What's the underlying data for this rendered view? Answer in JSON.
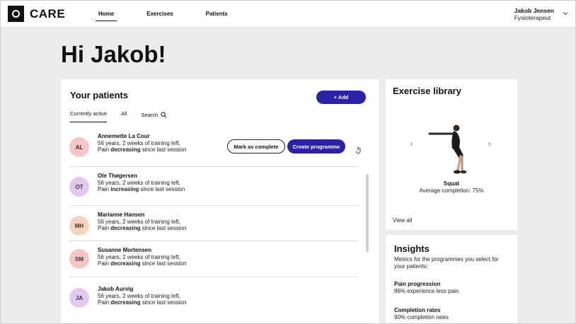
{
  "app": {
    "name": "CARE"
  },
  "nav": {
    "items": [
      "Home",
      "Exercises",
      "Patients"
    ]
  },
  "user": {
    "name": "Jakob Jensen",
    "role": "Fysioterapeut"
  },
  "greeting": "Hi Jakob!",
  "patients": {
    "title": "Your patients",
    "add_label": "+ Add",
    "tabs": [
      "Currently active",
      "All"
    ],
    "search_label": "Search",
    "mark_complete_label": "Mark as complete",
    "create_programme_label": "Create programme",
    "list": [
      {
        "initials": "AL",
        "name": "Annemette La Cour",
        "details": "56 years, 2 weeks of training left,",
        "pain_prefix": "Pain ",
        "pain_trend": "decreasing",
        "pain_suffix": " since last session",
        "avatar_color": "#f7c6c6"
      },
      {
        "initials": "OT",
        "name": "Ole Thøgersen",
        "details": "56 years, 2 weeks of training left,",
        "pain_prefix": "Pain ",
        "pain_trend": "increasing",
        "pain_suffix": " since last session",
        "avatar_color": "#e2c9f2"
      },
      {
        "initials": "MH",
        "name": "Marianne Hansen",
        "details": "56 years, 2 weeks of training left,",
        "pain_prefix": "Pain ",
        "pain_trend": "decreasing",
        "pain_suffix": " since last session",
        "avatar_color": "#f8d3bf"
      },
      {
        "initials": "SM",
        "name": "Susanne Mortensen",
        "details": "56 years, 2 weeks of training left,",
        "pain_prefix": "Pain ",
        "pain_trend": "decreasing",
        "pain_suffix": " since last session",
        "avatar_color": "#f7c6c6"
      },
      {
        "initials": "JA",
        "name": "Jakob Aurvig",
        "details": "56 years, 2 weeks of training left,",
        "pain_prefix": "Pain ",
        "pain_trend": "decreasing",
        "pain_suffix": " since last session",
        "avatar_color": "#e2c9f2"
      }
    ]
  },
  "library": {
    "title": "Exercise library",
    "exercise_name": "Squat",
    "average_completion": "Average completion: 75%",
    "view_all_label": "View all",
    "prev_icon": "chevron-left-icon",
    "next_icon": "chevron-right-icon"
  },
  "insights": {
    "title": "Insights",
    "description": "Metrics for the programmes you select for your patients:",
    "metrics": [
      {
        "title": "Pain progression",
        "value": "86% experience less pain"
      },
      {
        "title": "Completion rates",
        "value": "90% completion rates"
      }
    ]
  },
  "colors": {
    "accent": "#2b22a8",
    "background": "#ececec"
  }
}
